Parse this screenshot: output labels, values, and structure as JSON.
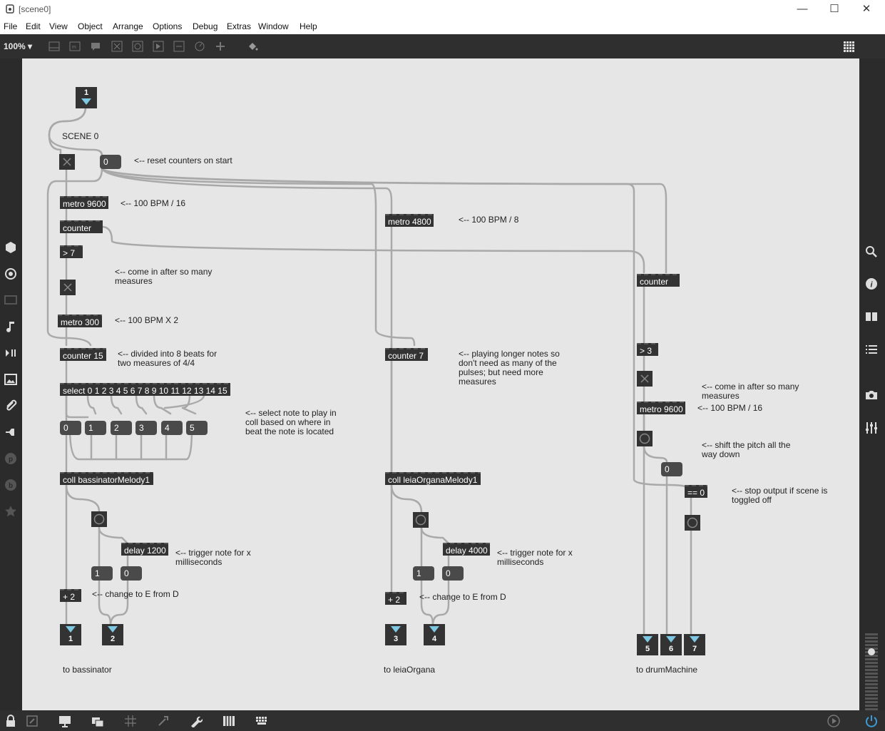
{
  "window": {
    "title": "[scene0]",
    "controls": {
      "minimize": "—",
      "maximize": "☐",
      "close": "✕"
    }
  },
  "menu": [
    "File",
    "Edit",
    "View",
    "Object",
    "Arrange",
    "Options",
    "Debug",
    "Extras",
    "Window",
    "Help"
  ],
  "toolbar": {
    "zoom": "100%",
    "zoom_arrow": "▾"
  },
  "inlet": {
    "number": "1"
  },
  "scene_label": "SCENE 0",
  "objects": {
    "metro1": "metro 9600",
    "counter1": "counter",
    "gt7": "> 7",
    "metro2": "metro 300",
    "counter15": "counter 15",
    "select": "select 0 1 2 3 4 5 6 7 8 9 10 11 12 13 14 15",
    "coll1": "coll bassinatorMelody1",
    "delay1": "delay 1200",
    "plus1": "+ 2",
    "metro3": "metro 4800",
    "counter7": "counter 7",
    "coll2": "coll leiaOrganaMelody1",
    "delay2": "delay 4000",
    "plus2": "+ 2",
    "counter3": "counter",
    "gt3": "> 3",
    "metro4": "metro 9600",
    "eq0": "== 0"
  },
  "messages": {
    "reset": "0",
    "m0": "0",
    "m1": "1",
    "m2": "2",
    "m3": "3",
    "m4": "4",
    "m5": "5",
    "one1": "1",
    "zero1": "0",
    "one2": "1",
    "zero2": "0",
    "zero3": "0"
  },
  "comments": {
    "reset": "<-- reset counters on start",
    "bpm16a": "<-- 100 BPM / 16",
    "comein1": "<-- come in after so many\nmeasures",
    "bpmx2": "<-- 100 BPM X 2",
    "divided": "<-- divided into 8 beats for\ntwo measures of 4/4",
    "select": "<-- select note to play in\ncoll based on where in\nbeat the note is located",
    "trigger1": "<-- trigger note for x\nmilliseconds",
    "change1": "<-- change to E from D",
    "bpm8": "<-- 100 BPM / 8",
    "longer": "<-- playing longer notes so\ndon't need as many of the\npulses; but need more\nmeasures",
    "trigger2": "<-- trigger note for x\nmilliseconds",
    "change2": "<-- change to E from D",
    "comein2": "<-- come in after so many\nmeasures",
    "bpm16b": "<-- 100 BPM / 16",
    "shift": "<-- shift the pitch all the\nway down",
    "stop": "<-- stop output if scene is\ntoggled off",
    "to_bass": "to bassinator",
    "to_leia": "to leiaOrgana",
    "to_drum": "to drumMachine"
  },
  "outlets": [
    "1",
    "2",
    "3",
    "4",
    "5",
    "6",
    "7"
  ],
  "colors": {
    "canvas": "#e6e6e6",
    "object": "#333333",
    "cord": "#a9a9a9",
    "chrome": "#2b2b2b"
  },
  "icons": {
    "left": [
      "package-icon",
      "target-icon",
      "monitor-icon",
      "note-icon",
      "step-icon",
      "image-icon",
      "clip-icon",
      "plug-icon",
      "p-icon",
      "b-icon",
      "star-icon"
    ],
    "right": [
      "search-icon",
      "info-icon",
      "book-icon",
      "list-icon",
      "camera-icon",
      "sliders-icon"
    ],
    "bottom": [
      "lock-icon",
      "edit-icon",
      "presentation-icon",
      "window-icon",
      "grid-icon",
      "snap-icon",
      "wrench-icon",
      "piano-icon",
      "keyboard-icon"
    ]
  }
}
